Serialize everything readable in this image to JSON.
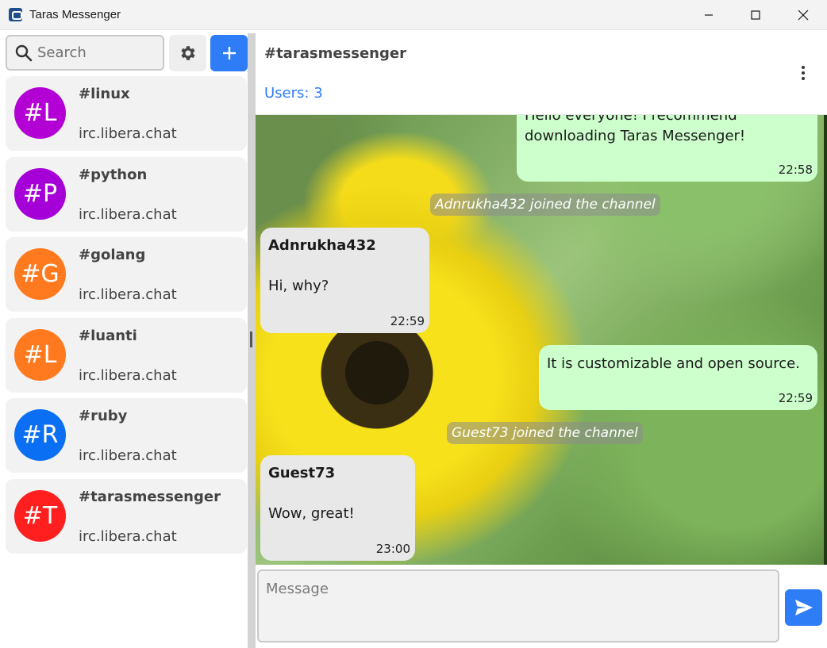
{
  "window": {
    "title": "Taras Messenger",
    "controls": {
      "minimize": "minimize-icon",
      "maximize": "maximize-icon",
      "close": "close-icon"
    }
  },
  "sidebar": {
    "search": {
      "placeholder": "Search",
      "icon": "search-icon"
    },
    "settings_icon": "gear-icon",
    "add_icon": "plus-icon",
    "channels": [
      {
        "initials": "#L",
        "name": "#linux",
        "server": "irc.libera.chat",
        "color": "#b300d4"
      },
      {
        "initials": "#P",
        "name": "#python",
        "server": "irc.libera.chat",
        "color": "#a600d9"
      },
      {
        "initials": "#G",
        "name": "#golang",
        "server": "irc.libera.chat",
        "color": "#ff7a1f"
      },
      {
        "initials": "#L",
        "name": "#luanti",
        "server": "irc.libera.chat",
        "color": "#ff7a1f"
      },
      {
        "initials": "#R",
        "name": "#ruby",
        "server": "irc.libera.chat",
        "color": "#0a6ff2"
      },
      {
        "initials": "#T",
        "name": "#tarasmessenger",
        "server": "irc.libera.chat",
        "color": "#ff1f1f"
      }
    ]
  },
  "chat": {
    "title": "#tarasmessenger",
    "users": "Users: 3",
    "more_icon": "more-vertical-icon",
    "messages": [
      {
        "kind": "own",
        "text_line1": "Hello everyone! I recommend",
        "text_line2": "downloading Taras Messenger!",
        "time": "22:58"
      },
      {
        "kind": "system",
        "text": "Adnrukha432 joined the channel"
      },
      {
        "kind": "incoming",
        "sender": "Adnrukha432",
        "text": "Hi, why?",
        "time": "22:59"
      },
      {
        "kind": "own",
        "text": "It is customizable and open source.",
        "time": "22:59"
      },
      {
        "kind": "system",
        "text": "Guest73 joined the channel"
      },
      {
        "kind": "incoming",
        "sender": "Guest73",
        "text": "Wow, great!",
        "time": "23:00"
      }
    ]
  },
  "composer": {
    "placeholder": "Message",
    "send_icon": "send-icon"
  },
  "colors": {
    "accent": "#2e7cf6",
    "own_bubble": "#ccffcc",
    "incoming_bubble": "#e8e8e8"
  }
}
